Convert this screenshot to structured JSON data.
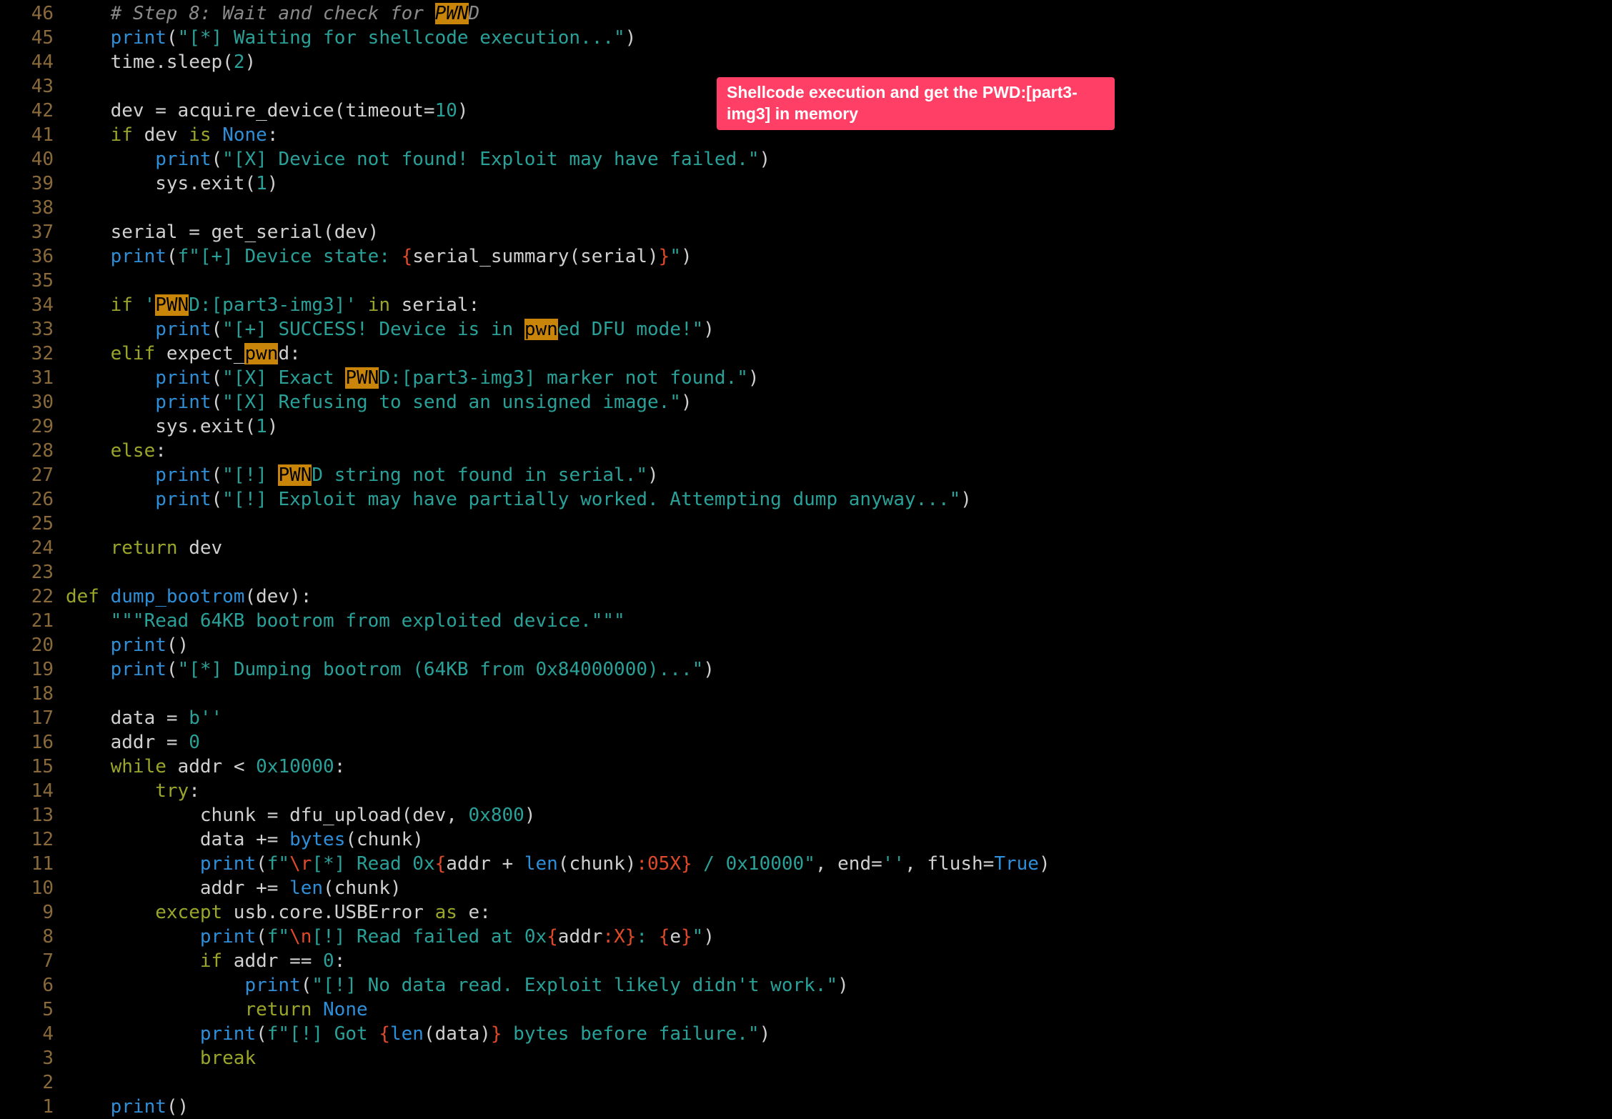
{
  "editor": {
    "lines": [
      {
        "n": "46",
        "t": [
          [
            "",
            "    "
          ],
          [
            "comment",
            "# Step 8: Wait and check for "
          ],
          [
            "comment hl",
            "PWN"
          ],
          [
            "comment",
            "D"
          ]
        ]
      },
      {
        "n": "45",
        "t": [
          [
            "",
            "    "
          ],
          [
            "call",
            "print"
          ],
          [
            "plain",
            "("
          ],
          [
            "str",
            "\"[*] Waiting for shellcode execution...\""
          ],
          [
            "plain",
            ")"
          ]
        ]
      },
      {
        "n": "44",
        "t": [
          [
            "",
            "    "
          ],
          [
            "plain",
            "time.sleep("
          ],
          [
            "num",
            "2"
          ],
          [
            "plain",
            ")"
          ]
        ]
      },
      {
        "n": "43",
        "t": []
      },
      {
        "n": "42",
        "t": [
          [
            "",
            "    "
          ],
          [
            "plain",
            "dev = acquire_device(timeout="
          ],
          [
            "num",
            "10"
          ],
          [
            "plain",
            ")"
          ]
        ]
      },
      {
        "n": "41",
        "t": [
          [
            "",
            "    "
          ],
          [
            "kw",
            "if"
          ],
          [
            "plain",
            " dev "
          ],
          [
            "kw",
            "is"
          ],
          [
            "plain",
            " "
          ],
          [
            "const",
            "None"
          ],
          [
            "plain",
            ":"
          ]
        ]
      },
      {
        "n": "40",
        "t": [
          [
            "",
            "        "
          ],
          [
            "call",
            "print"
          ],
          [
            "plain",
            "("
          ],
          [
            "str",
            "\"[X] Device not found! Exploit may have failed.\""
          ],
          [
            "plain",
            ")"
          ]
        ]
      },
      {
        "n": "39",
        "t": [
          [
            "",
            "        "
          ],
          [
            "plain",
            "sys.exit("
          ],
          [
            "num",
            "1"
          ],
          [
            "plain",
            ")"
          ]
        ]
      },
      {
        "n": "38",
        "t": []
      },
      {
        "n": "37",
        "t": [
          [
            "",
            "    "
          ],
          [
            "plain",
            "serial = get_serial(dev)"
          ]
        ]
      },
      {
        "n": "36",
        "t": [
          [
            "",
            "    "
          ],
          [
            "call",
            "print"
          ],
          [
            "plain",
            "("
          ],
          [
            "str",
            "f\"[+] Device state: "
          ],
          [
            "fmt",
            "{"
          ],
          [
            "plain",
            "serial_summary(serial)"
          ],
          [
            "fmt",
            "}"
          ],
          [
            "str",
            "\""
          ],
          [
            "plain",
            ")"
          ]
        ]
      },
      {
        "n": "35",
        "t": []
      },
      {
        "n": "34",
        "t": [
          [
            "",
            "    "
          ],
          [
            "kw",
            "if"
          ],
          [
            "plain",
            " "
          ],
          [
            "str",
            "'"
          ],
          [
            "hl",
            "PWN"
          ],
          [
            "str",
            "D:[part3-img3]'"
          ],
          [
            "plain",
            " "
          ],
          [
            "kw",
            "in"
          ],
          [
            "plain",
            " serial:"
          ]
        ]
      },
      {
        "n": "33",
        "t": [
          [
            "",
            "        "
          ],
          [
            "call",
            "print"
          ],
          [
            "plain",
            "("
          ],
          [
            "str",
            "\"[+] SUCCESS! Device is in "
          ],
          [
            "hl",
            "pwn"
          ],
          [
            "str",
            "ed DFU mode!\""
          ],
          [
            "plain",
            ")"
          ]
        ]
      },
      {
        "n": "32",
        "t": [
          [
            "",
            "    "
          ],
          [
            "kw",
            "elif"
          ],
          [
            "plain",
            " expect_"
          ],
          [
            "hl",
            "pwn"
          ],
          [
            "plain",
            "d:"
          ]
        ]
      },
      {
        "n": "31",
        "t": [
          [
            "",
            "        "
          ],
          [
            "call",
            "print"
          ],
          [
            "plain",
            "("
          ],
          [
            "str",
            "\"[X] Exact "
          ],
          [
            "hl",
            "PWN"
          ],
          [
            "str",
            "D:[part3-img3] marker not found.\""
          ],
          [
            "plain",
            ")"
          ]
        ]
      },
      {
        "n": "30",
        "t": [
          [
            "",
            "        "
          ],
          [
            "call",
            "print"
          ],
          [
            "plain",
            "("
          ],
          [
            "str",
            "\"[X] Refusing to send an unsigned image.\""
          ],
          [
            "plain",
            ")"
          ]
        ]
      },
      {
        "n": "29",
        "t": [
          [
            "",
            "        "
          ],
          [
            "plain",
            "sys.exit("
          ],
          [
            "num",
            "1"
          ],
          [
            "plain",
            ")"
          ]
        ]
      },
      {
        "n": "28",
        "t": [
          [
            "",
            "    "
          ],
          [
            "kw",
            "else"
          ],
          [
            "plain",
            ":"
          ]
        ]
      },
      {
        "n": "27",
        "t": [
          [
            "",
            "        "
          ],
          [
            "call",
            "print"
          ],
          [
            "plain",
            "("
          ],
          [
            "str",
            "\"[!] "
          ],
          [
            "hl",
            "PWN"
          ],
          [
            "str",
            "D string not found in serial.\""
          ],
          [
            "plain",
            ")"
          ]
        ]
      },
      {
        "n": "26",
        "t": [
          [
            "",
            "        "
          ],
          [
            "call",
            "print"
          ],
          [
            "plain",
            "("
          ],
          [
            "str",
            "\"[!] Exploit may have partially worked. Attempting dump anyway...\""
          ],
          [
            "plain",
            ")"
          ]
        ]
      },
      {
        "n": "25",
        "t": []
      },
      {
        "n": "24",
        "t": [
          [
            "",
            "    "
          ],
          [
            "kw",
            "return"
          ],
          [
            "plain",
            " dev"
          ]
        ]
      },
      {
        "n": "23",
        "t": []
      },
      {
        "n": "22",
        "t": [
          [
            "kw",
            "def"
          ],
          [
            "plain",
            " "
          ],
          [
            "call",
            "dump_bootrom"
          ],
          [
            "plain",
            "(dev):"
          ]
        ]
      },
      {
        "n": "21",
        "t": [
          [
            "",
            "    "
          ],
          [
            "str",
            "\"\"\"Read 64KB bootrom from exploited device.\"\"\""
          ]
        ]
      },
      {
        "n": "20",
        "t": [
          [
            "",
            "    "
          ],
          [
            "call",
            "print"
          ],
          [
            "plain",
            "()"
          ]
        ]
      },
      {
        "n": "19",
        "t": [
          [
            "",
            "    "
          ],
          [
            "call",
            "print"
          ],
          [
            "plain",
            "("
          ],
          [
            "str",
            "\"[*] Dumping bootrom (64KB from 0x84000000)...\""
          ],
          [
            "plain",
            ")"
          ]
        ]
      },
      {
        "n": "18",
        "t": []
      },
      {
        "n": "17",
        "t": [
          [
            "",
            "    "
          ],
          [
            "plain",
            "data = "
          ],
          [
            "str",
            "b''"
          ]
        ]
      },
      {
        "n": "16",
        "t": [
          [
            "",
            "    "
          ],
          [
            "plain",
            "addr = "
          ],
          [
            "num",
            "0"
          ]
        ]
      },
      {
        "n": "15",
        "t": [
          [
            "",
            "    "
          ],
          [
            "kw",
            "while"
          ],
          [
            "plain",
            " addr < "
          ],
          [
            "num",
            "0x10000"
          ],
          [
            "plain",
            ":"
          ]
        ]
      },
      {
        "n": "14",
        "t": [
          [
            "",
            "        "
          ],
          [
            "kw",
            "try"
          ],
          [
            "plain",
            ":"
          ]
        ]
      },
      {
        "n": "13",
        "t": [
          [
            "",
            "            "
          ],
          [
            "plain",
            "chunk = dfu_upload(dev, "
          ],
          [
            "num",
            "0x800"
          ],
          [
            "plain",
            ")"
          ]
        ]
      },
      {
        "n": "12",
        "t": [
          [
            "",
            "            "
          ],
          [
            "plain",
            "data += "
          ],
          [
            "call",
            "bytes"
          ],
          [
            "plain",
            "(chunk)"
          ]
        ]
      },
      {
        "n": "11",
        "t": [
          [
            "",
            "            "
          ],
          [
            "call",
            "print"
          ],
          [
            "plain",
            "("
          ],
          [
            "str",
            "f\""
          ],
          [
            "fmt",
            "\\r"
          ],
          [
            "str",
            "[*] Read 0x"
          ],
          [
            "fmt",
            "{"
          ],
          [
            "plain",
            "addr + "
          ],
          [
            "call",
            "len"
          ],
          [
            "plain",
            "(chunk)"
          ],
          [
            "fmt",
            ":05X}"
          ],
          [
            "str",
            " / 0x10000\""
          ],
          [
            "plain",
            ", end="
          ],
          [
            "str",
            "''"
          ],
          [
            "plain",
            ", flush="
          ],
          [
            "const",
            "True"
          ],
          [
            "plain",
            ")"
          ]
        ]
      },
      {
        "n": "10",
        "t": [
          [
            "",
            "            "
          ],
          [
            "plain",
            "addr += "
          ],
          [
            "call",
            "len"
          ],
          [
            "plain",
            "(chunk)"
          ]
        ]
      },
      {
        "n": "9",
        "t": [
          [
            "",
            "        "
          ],
          [
            "kw",
            "except"
          ],
          [
            "plain",
            " usb.core.USBError "
          ],
          [
            "kw",
            "as"
          ],
          [
            "plain",
            " e:"
          ]
        ]
      },
      {
        "n": "8",
        "t": [
          [
            "",
            "            "
          ],
          [
            "call",
            "print"
          ],
          [
            "plain",
            "("
          ],
          [
            "str",
            "f\""
          ],
          [
            "fmt",
            "\\n"
          ],
          [
            "str",
            "[!] Read failed at 0x"
          ],
          [
            "fmt",
            "{"
          ],
          [
            "plain",
            "addr"
          ],
          [
            "fmt",
            ":X}"
          ],
          [
            "str",
            ": "
          ],
          [
            "fmt",
            "{"
          ],
          [
            "plain",
            "e"
          ],
          [
            "fmt",
            "}"
          ],
          [
            "str",
            "\""
          ],
          [
            "plain",
            ")"
          ]
        ]
      },
      {
        "n": "7",
        "t": [
          [
            "",
            "            "
          ],
          [
            "kw",
            "if"
          ],
          [
            "plain",
            " addr == "
          ],
          [
            "num",
            "0"
          ],
          [
            "plain",
            ":"
          ]
        ]
      },
      {
        "n": "6",
        "t": [
          [
            "",
            "                "
          ],
          [
            "call",
            "print"
          ],
          [
            "plain",
            "("
          ],
          [
            "str",
            "\"[!] No data read. Exploit likely didn't work.\""
          ],
          [
            "plain",
            ")"
          ]
        ]
      },
      {
        "n": "5",
        "t": [
          [
            "",
            "                "
          ],
          [
            "kw",
            "return"
          ],
          [
            "plain",
            " "
          ],
          [
            "const",
            "None"
          ]
        ]
      },
      {
        "n": "4",
        "t": [
          [
            "",
            "            "
          ],
          [
            "call",
            "print"
          ],
          [
            "plain",
            "("
          ],
          [
            "str",
            "f\"[!] Got "
          ],
          [
            "fmt",
            "{"
          ],
          [
            "call",
            "len"
          ],
          [
            "plain",
            "(data)"
          ],
          [
            "fmt",
            "}"
          ],
          [
            "str",
            " bytes before failure.\""
          ],
          [
            "plain",
            ")"
          ]
        ]
      },
      {
        "n": "3",
        "t": [
          [
            "",
            "            "
          ],
          [
            "kw",
            "break"
          ]
        ]
      },
      {
        "n": "2",
        "t": []
      },
      {
        "n": "1",
        "t": [
          [
            "",
            "    "
          ],
          [
            "call",
            "print"
          ],
          [
            "plain",
            "()"
          ]
        ]
      }
    ]
  },
  "annotation": {
    "text": "Shellcode execution and get the PWD:[part3-img3] in memory"
  }
}
